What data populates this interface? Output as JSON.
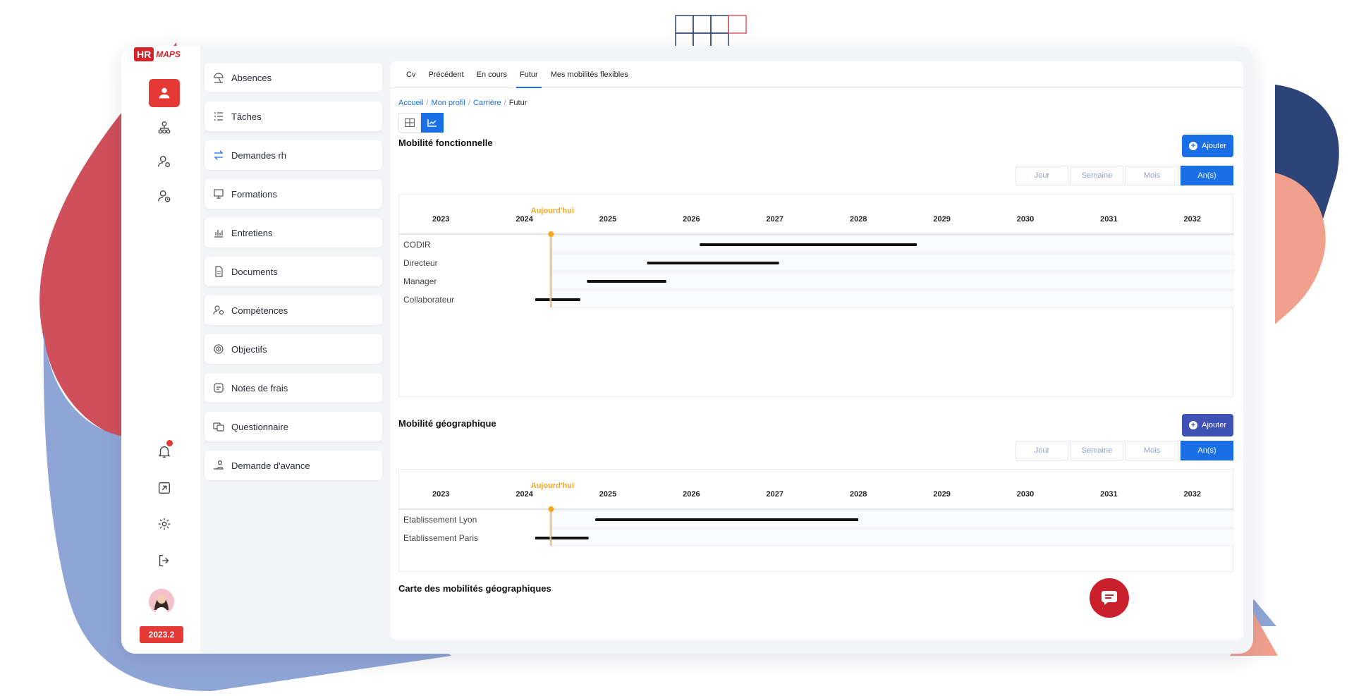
{
  "brand": {
    "hr": "HR",
    "maps": "MAPS",
    "year_badge": "2023.2"
  },
  "rail": {
    "items": [
      {
        "icon": "user-icon",
        "active": true
      },
      {
        "icon": "org-chart-icon",
        "active": false
      },
      {
        "icon": "user-settings-icon",
        "active": false
      },
      {
        "icon": "user-clock-icon",
        "active": false
      }
    ],
    "bottom": [
      {
        "icon": "bell-icon"
      },
      {
        "icon": "external-link-icon"
      },
      {
        "icon": "gear-icon"
      },
      {
        "icon": "logout-icon"
      }
    ]
  },
  "modules": [
    {
      "label": "Absences",
      "icon": "beach-umbrella-icon"
    },
    {
      "label": "Tâches",
      "icon": "task-list-icon"
    },
    {
      "label": "Demandes rh",
      "icon": "exchange-icon"
    },
    {
      "label": "Formations",
      "icon": "training-icon"
    },
    {
      "label": "Entretiens",
      "icon": "chart-icon"
    },
    {
      "label": "Documents",
      "icon": "document-icon"
    },
    {
      "label": "Compétences",
      "icon": "skills-icon"
    },
    {
      "label": "Objectifs",
      "icon": "target-icon"
    },
    {
      "label": "Notes de frais",
      "icon": "receipt-icon"
    },
    {
      "label": "Questionnaire",
      "icon": "questionnaire-icon"
    },
    {
      "label": "Demande d'avance",
      "icon": "hand-coin-icon"
    }
  ],
  "tabs": [
    {
      "label": "Cv",
      "active": false
    },
    {
      "label": "Précédent",
      "active": false
    },
    {
      "label": "En cours",
      "active": false
    },
    {
      "label": "Futur",
      "active": true
    },
    {
      "label": "Mes mobilités flexibles",
      "active": false
    }
  ],
  "breadcrumb": {
    "items": [
      "Accueil",
      "Mon profil",
      "Carrière"
    ],
    "current": "Futur"
  },
  "scale_options": [
    "Jour",
    "Semaine",
    "Mois",
    "An(s)"
  ],
  "scale_selected": "An(s)",
  "today_label": "Aujourd'hui",
  "functional": {
    "title": "Mobilité fonctionnelle",
    "add_label": "Ajouter",
    "years": [
      "2023",
      "2024",
      "2025",
      "2026",
      "2027",
      "2028",
      "2029",
      "2030",
      "2031",
      "2032"
    ],
    "today": 2024.37,
    "rows": [
      {
        "label": "CODIR",
        "start": 2026.15,
        "end": 2028.75
      },
      {
        "label": "Directeur",
        "start": 2025.52,
        "end": 2027.1
      },
      {
        "label": "Manager",
        "start": 2024.8,
        "end": 2025.75
      },
      {
        "label": "Collaborateur",
        "start": 2024.18,
        "end": 2024.72
      }
    ]
  },
  "geographic": {
    "title": "Mobilité géographique",
    "add_label": "Ajouter",
    "years": [
      "2023",
      "2024",
      "2025",
      "2026",
      "2027",
      "2028",
      "2029",
      "2030",
      "2031",
      "2032"
    ],
    "today": 2024.37,
    "rows": [
      {
        "label": "Etablissement  Lyon",
        "start": 2024.9,
        "end": 2028.05
      },
      {
        "label": "Etablissement  Paris",
        "start": 2024.18,
        "end": 2024.82
      }
    ]
  },
  "map_title": "Carte des mobilités géographiques",
  "colors": {
    "accent": "#1a6fe6",
    "brand_red": "#e53935",
    "today": "#f5a623",
    "indigo": "#3f51b5"
  }
}
